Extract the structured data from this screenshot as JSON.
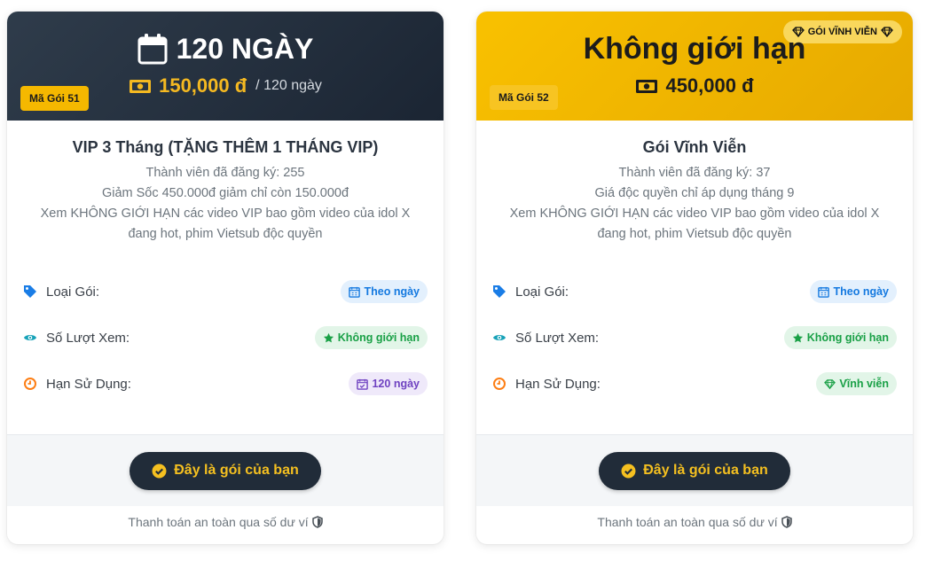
{
  "plans": [
    {
      "title": "120 NGÀY",
      "price": "150,000 đ",
      "period": "/ 120 ngày",
      "code": "Mã Gói 51",
      "name": "VIP 3 Tháng (TẶNG THÊM 1 THÁNG VIP)",
      "lines": [
        "Thành viên đã đăng ký: 255",
        "Giảm Sốc 450.000đ giảm chỉ còn 150.000đ",
        "Xem KHÔNG GIỚI HẠN các video VIP bao gồm video của idol X đang hot, phim Vietsub độc quyền"
      ],
      "features": {
        "type_label": "Loại Gói:",
        "type_value": "Theo ngày",
        "views_label": "Số Lượt Xem:",
        "views_value": "Không giới hạn",
        "expiry_label": "Hạn Sử Dụng:",
        "expiry_value": "120 ngày"
      },
      "button": "Đây là gói của bạn",
      "secure": "Thanh toán an toàn qua số dư ví"
    },
    {
      "title": "Không giới hạn",
      "price": "450,000 đ",
      "code": "Mã Gói 52",
      "badge": "GÓI VĨNH VIỄN",
      "name": "Gói Vĩnh Viễn",
      "lines": [
        "Thành viên đã đăng ký: 37",
        "Giá độc quyền chỉ áp dụng tháng 9",
        "Xem KHÔNG GIỚI HẠN các video VIP bao gồm video của idol X đang hot, phim Vietsub độc quyền"
      ],
      "features": {
        "type_label": "Loại Gói:",
        "type_value": "Theo ngày",
        "views_label": "Số Lượt Xem:",
        "views_value": "Không giới hạn",
        "expiry_label": "Hạn Sử Dụng:",
        "expiry_value": "Vĩnh viễn"
      },
      "button": "Đây là gói của bạn",
      "secure": "Thanh toán an toàn qua số dư ví"
    }
  ],
  "colors": {
    "dark": "#1b2533",
    "gold": "#f5b800",
    "accent_text": "#f5c020"
  },
  "icons": [
    "calendar-icon",
    "money-icon",
    "gem-icon",
    "tag-icon",
    "eye-icon",
    "clock-icon",
    "star-icon",
    "calendar-check-icon",
    "check-circle-icon",
    "shield-icon"
  ]
}
